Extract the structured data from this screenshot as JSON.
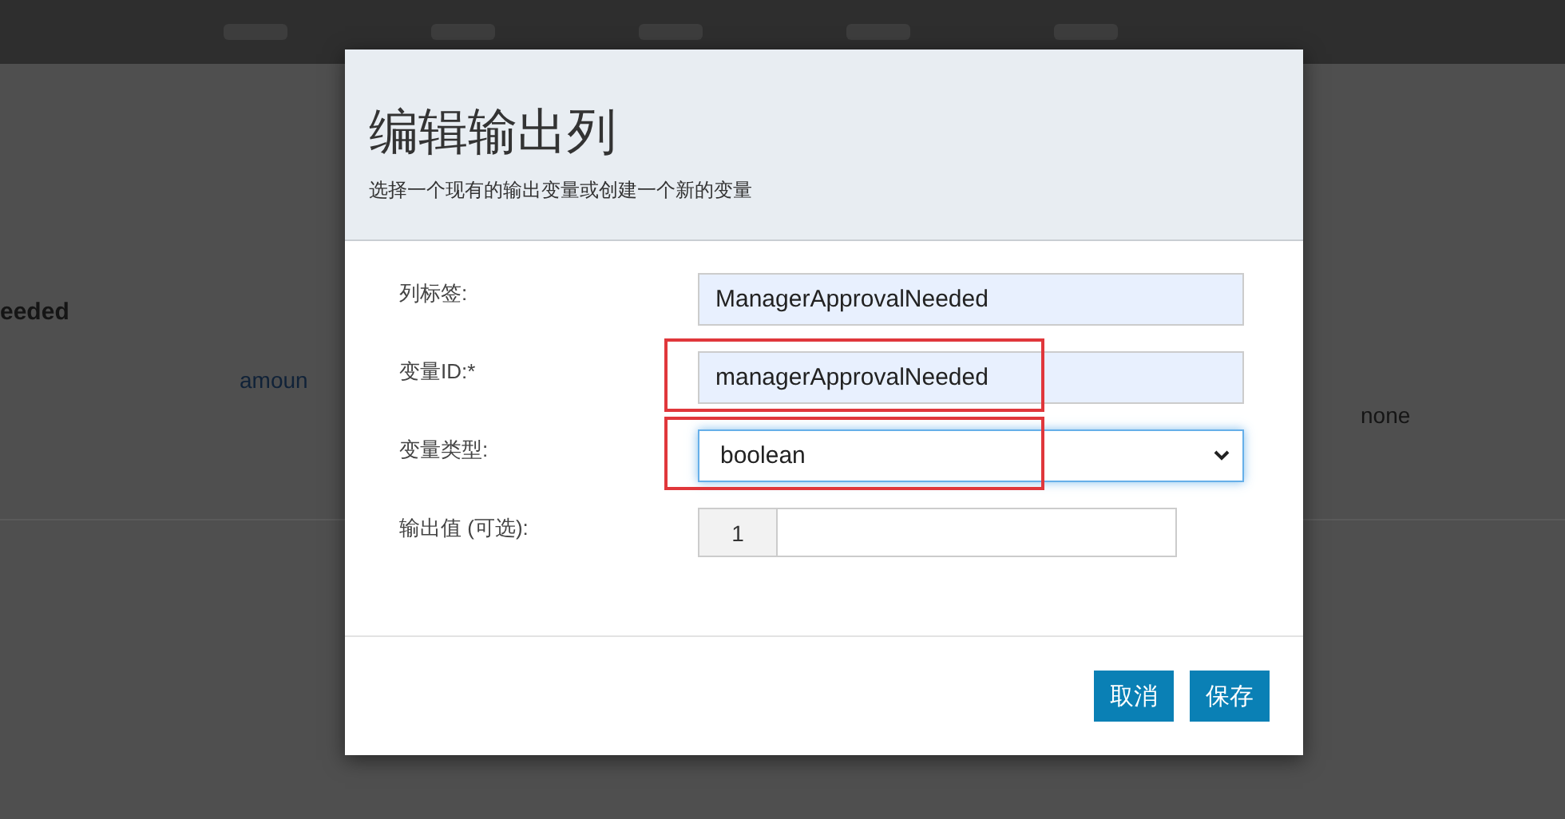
{
  "background": {
    "texts": [
      {
        "kind": "heading",
        "text": "eeded"
      },
      {
        "kind": "link",
        "text": "amoun"
      },
      {
        "kind": "value",
        "text": "none"
      }
    ]
  },
  "dialog": {
    "title": "编辑输出列",
    "subtitle": "选择一个现有的输出变量或创建一个新的变量",
    "fields": [
      {
        "kind": "text",
        "label": "列标签:",
        "value": "ManagerApprovalNeeded",
        "autofilled": true,
        "highlighted": false,
        "focused": false
      },
      {
        "kind": "text",
        "label": "变量ID:*",
        "value": "managerApprovalNeeded",
        "autofilled": true,
        "highlighted": true,
        "focused": false
      },
      {
        "kind": "select",
        "label": "变量类型:",
        "value": "boolean",
        "autofilled": false,
        "highlighted": true,
        "focused": true
      },
      {
        "kind": "addon",
        "label": "输出值 (可选):",
        "addon": "1",
        "autofilled": false,
        "highlighted": false,
        "focused": false
      }
    ],
    "buttons": [
      "取消",
      "保存"
    ]
  }
}
